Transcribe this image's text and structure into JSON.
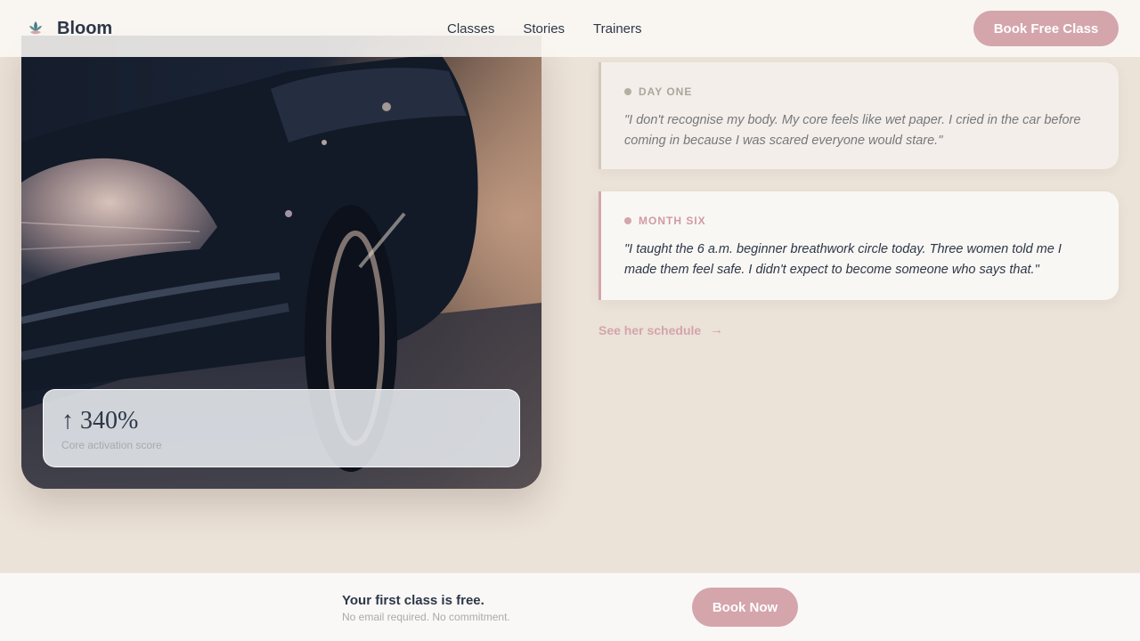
{
  "brand": {
    "name": "Bloom",
    "logo_icon": "lotus-icon"
  },
  "nav": {
    "items": [
      {
        "label": "Classes"
      },
      {
        "label": "Stories"
      },
      {
        "label": "Trainers"
      }
    ]
  },
  "header_cta": {
    "label": "Book Free Class"
  },
  "hero_image": {
    "description_icon": "car-photo",
    "stat": {
      "value": "↑ 340%",
      "label": "Core activation score"
    }
  },
  "testimonials": [
    {
      "tag": "DAY ONE",
      "quote": "\"I don't recognise my body. My core feels like wet paper. I cried in the car before coming in because I was scared everyone would stare.\""
    },
    {
      "tag": "MONTH SIX",
      "quote": "\"I taught the 6 a.m. beginner breathwork circle today. Three women told me I made them feel safe. I didn't expect to become someone who says that.\""
    }
  ],
  "schedule_link": {
    "label": "See her schedule",
    "icon": "arrow-right-icon"
  },
  "bottom_bar": {
    "title": "Your first class is free.",
    "subtitle": "No email required. No commitment.",
    "cta_label": "Book Now"
  },
  "colors": {
    "accent": "#d4a5ab",
    "text": "#2c3747",
    "background": "#ebe2d8"
  }
}
